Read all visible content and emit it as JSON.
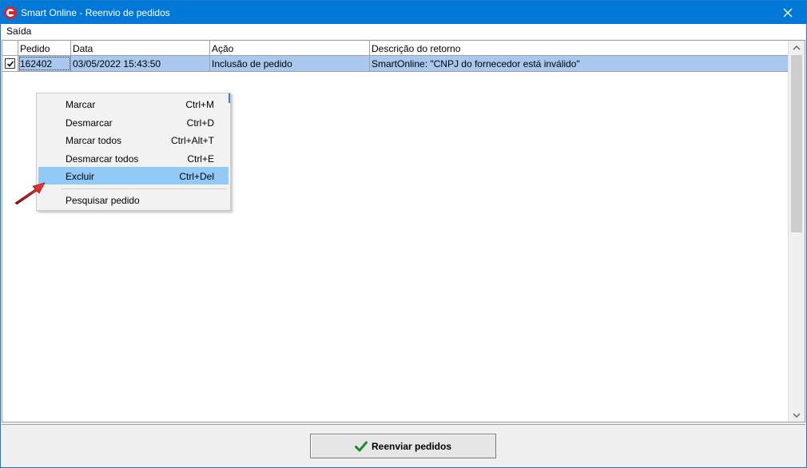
{
  "window": {
    "title": "Smart Online - Reenvio de pedidos",
    "app_icon": "app-logo-icon",
    "close_icon": "close-icon"
  },
  "menubar": {
    "items": [
      {
        "label": "Saída"
      }
    ]
  },
  "grid": {
    "columns": [
      "Pedido",
      "Data",
      "Ação",
      "Descrição do retorno"
    ],
    "rows": [
      {
        "checked": true,
        "pedido": "162402",
        "data": "03/05/2022 15:43:50",
        "acao": "Inclusão de pedido",
        "descricao": "SmartOnline: \"CNPJ do fornecedor está inválido\""
      }
    ],
    "selection_color": "#a8c8f0"
  },
  "context_menu": {
    "items": [
      {
        "label": "Marcar",
        "shortcut": "Ctrl+M"
      },
      {
        "label": "Desmarcar",
        "shortcut": "Ctrl+D"
      },
      {
        "label": "Marcar todos",
        "shortcut": "Ctrl+Alt+T"
      },
      {
        "label": "Desmarcar todos",
        "shortcut": "Ctrl+E"
      },
      {
        "label": "Excluir",
        "shortcut": "Ctrl+Del",
        "highlighted": true
      },
      {
        "label": "Pesquisar pedido",
        "shortcut": ""
      }
    ],
    "highlight_color": "#91c9f7"
  },
  "footer": {
    "resend_button_label": "Reenviar pedidos",
    "button_icon": "green-checkmark-icon"
  },
  "annotation": {
    "icon": "red-pointer-arrow-icon",
    "color": "#d42020"
  }
}
